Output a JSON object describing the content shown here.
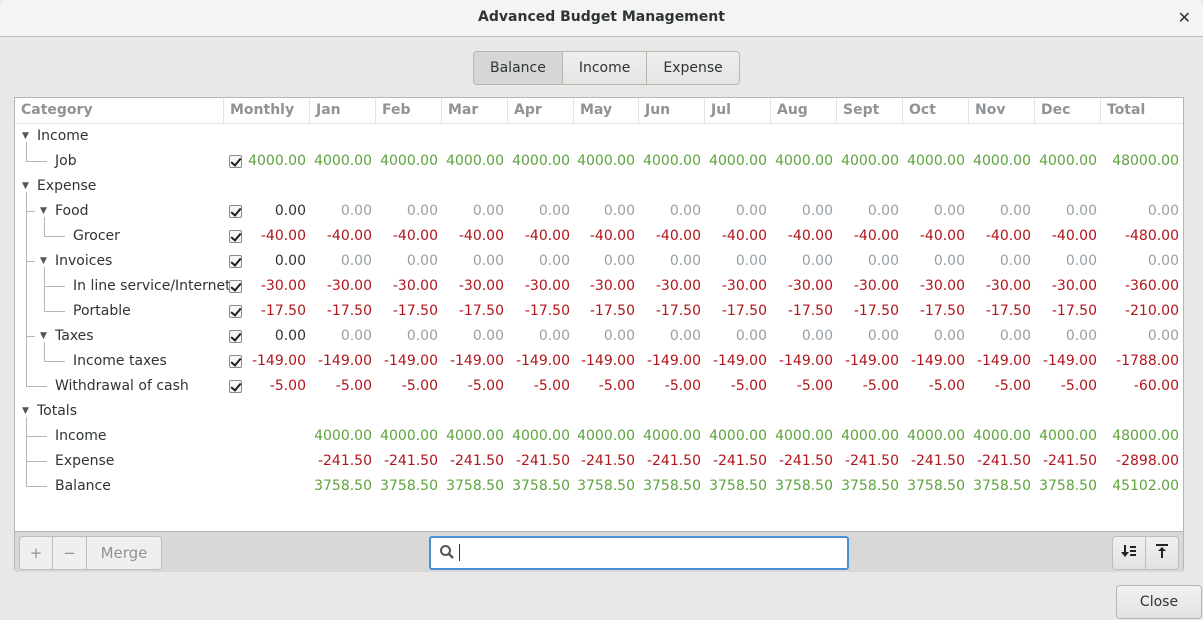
{
  "window": {
    "title": "Advanced Budget Management",
    "close_icon": "close-icon"
  },
  "view_switcher": {
    "tabs": [
      {
        "label": "Balance",
        "active": true
      },
      {
        "label": "Income",
        "active": false
      },
      {
        "label": "Expense",
        "active": false
      }
    ]
  },
  "table": {
    "columns": [
      "Category",
      "Monthly",
      "Jan",
      "Feb",
      "Mar",
      "Apr",
      "May",
      "Jun",
      "Jul",
      "Aug",
      "Sept",
      "Oct",
      "Nov",
      "Dec",
      "Total"
    ],
    "rows": [
      {
        "label": "Income",
        "level": 0,
        "expander": true,
        "checkbox": false,
        "monthly": null,
        "values": [],
        "total": null
      },
      {
        "label": "Job",
        "level": 1,
        "expander": false,
        "checkbox": true,
        "checked": true,
        "monthly": "4000.00",
        "monthly_style": "pos",
        "values": [
          "4000.00",
          "4000.00",
          "4000.00",
          "4000.00",
          "4000.00",
          "4000.00",
          "4000.00",
          "4000.00",
          "4000.00",
          "4000.00",
          "4000.00",
          "4000.00"
        ],
        "style": "pos",
        "total": "48000.00"
      },
      {
        "label": "Expense",
        "level": 0,
        "expander": true,
        "checkbox": false,
        "monthly": null,
        "values": [],
        "total": null
      },
      {
        "label": "Food",
        "level": 1,
        "expander": true,
        "checkbox": true,
        "checked": true,
        "monthly": "0.00",
        "monthly_style": "black",
        "values": [
          "0.00",
          "0.00",
          "0.00",
          "0.00",
          "0.00",
          "0.00",
          "0.00",
          "0.00",
          "0.00",
          "0.00",
          "0.00",
          "0.00"
        ],
        "style": "zero",
        "total": "0.00"
      },
      {
        "label": "Grocer",
        "level": 2,
        "expander": false,
        "checkbox": true,
        "checked": true,
        "monthly": "-40.00",
        "monthly_style": "neg",
        "values": [
          "-40.00",
          "-40.00",
          "-40.00",
          "-40.00",
          "-40.00",
          "-40.00",
          "-40.00",
          "-40.00",
          "-40.00",
          "-40.00",
          "-40.00",
          "-40.00"
        ],
        "style": "neg",
        "total": "-480.00"
      },
      {
        "label": "Invoices",
        "level": 1,
        "expander": true,
        "checkbox": true,
        "checked": true,
        "monthly": "0.00",
        "monthly_style": "black",
        "values": [
          "0.00",
          "0.00",
          "0.00",
          "0.00",
          "0.00",
          "0.00",
          "0.00",
          "0.00",
          "0.00",
          "0.00",
          "0.00",
          "0.00"
        ],
        "style": "zero",
        "total": "0.00"
      },
      {
        "label": "In line service/Internet",
        "level": 2,
        "expander": false,
        "checkbox": true,
        "checked": true,
        "monthly": "-30.00",
        "monthly_style": "neg",
        "values": [
          "-30.00",
          "-30.00",
          "-30.00",
          "-30.00",
          "-30.00",
          "-30.00",
          "-30.00",
          "-30.00",
          "-30.00",
          "-30.00",
          "-30.00",
          "-30.00"
        ],
        "style": "neg",
        "total": "-360.00"
      },
      {
        "label": "Portable",
        "level": 2,
        "expander": false,
        "checkbox": true,
        "checked": true,
        "monthly": "-17.50",
        "monthly_style": "neg",
        "values": [
          "-17.50",
          "-17.50",
          "-17.50",
          "-17.50",
          "-17.50",
          "-17.50",
          "-17.50",
          "-17.50",
          "-17.50",
          "-17.50",
          "-17.50",
          "-17.50"
        ],
        "style": "neg",
        "total": "-210.00"
      },
      {
        "label": "Taxes",
        "level": 1,
        "expander": true,
        "checkbox": true,
        "checked": true,
        "monthly": "0.00",
        "monthly_style": "black",
        "values": [
          "0.00",
          "0.00",
          "0.00",
          "0.00",
          "0.00",
          "0.00",
          "0.00",
          "0.00",
          "0.00",
          "0.00",
          "0.00",
          "0.00"
        ],
        "style": "zero",
        "total": "0.00"
      },
      {
        "label": "Income taxes",
        "level": 2,
        "expander": false,
        "checkbox": true,
        "checked": true,
        "monthly": "-149.00",
        "monthly_style": "neg",
        "values": [
          "-149.00",
          "-149.00",
          "-149.00",
          "-149.00",
          "-149.00",
          "-149.00",
          "-149.00",
          "-149.00",
          "-149.00",
          "-149.00",
          "-149.00",
          "-149.00"
        ],
        "style": "neg",
        "total": "-1788.00"
      },
      {
        "label": "Withdrawal of cash",
        "level": 1,
        "expander": false,
        "checkbox": true,
        "checked": true,
        "monthly": "-5.00",
        "monthly_style": "neg",
        "values": [
          "-5.00",
          "-5.00",
          "-5.00",
          "-5.00",
          "-5.00",
          "-5.00",
          "-5.00",
          "-5.00",
          "-5.00",
          "-5.00",
          "-5.00",
          "-5.00"
        ],
        "style": "neg",
        "total": "-60.00"
      },
      {
        "label": "Totals",
        "level": 0,
        "expander": true,
        "checkbox": false,
        "monthly": null,
        "values": [],
        "total": null
      },
      {
        "label": "Income",
        "level": 1,
        "expander": false,
        "checkbox": false,
        "monthly": null,
        "values": [
          "4000.00",
          "4000.00",
          "4000.00",
          "4000.00",
          "4000.00",
          "4000.00",
          "4000.00",
          "4000.00",
          "4000.00",
          "4000.00",
          "4000.00",
          "4000.00"
        ],
        "style": "pos",
        "total": "48000.00"
      },
      {
        "label": "Expense",
        "level": 1,
        "expander": false,
        "checkbox": false,
        "monthly": null,
        "values": [
          "-241.50",
          "-241.50",
          "-241.50",
          "-241.50",
          "-241.50",
          "-241.50",
          "-241.50",
          "-241.50",
          "-241.50",
          "-241.50",
          "-241.50",
          "-241.50"
        ],
        "style": "neg",
        "total": "-2898.00"
      },
      {
        "label": "Balance",
        "level": 1,
        "expander": false,
        "checkbox": false,
        "monthly": null,
        "values": [
          "3758.50",
          "3758.50",
          "3758.50",
          "3758.50",
          "3758.50",
          "3758.50",
          "3758.50",
          "3758.50",
          "3758.50",
          "3758.50",
          "3758.50",
          "3758.50"
        ],
        "style": "pos",
        "total": "45102.00"
      }
    ]
  },
  "footer": {
    "add_label": "+",
    "remove_label": "−",
    "merge_label": "Merge",
    "search": {
      "value": "",
      "placeholder": "",
      "icon": "search-icon"
    },
    "expand_icon": "expand-all-icon",
    "collapse_icon": "collapse-all-icon"
  },
  "close_button_label": "Close",
  "colors": {
    "positive": "#5da33e",
    "negative": "#b0161c",
    "zero": "#98a0a6",
    "accent": "#4a90d9"
  }
}
